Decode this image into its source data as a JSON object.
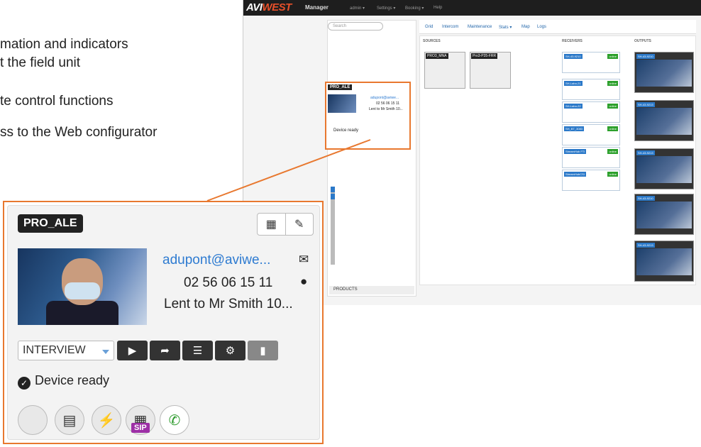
{
  "bullets": [
    "mation and indicators",
    "t the field unit",
    "te control functions",
    "ss to the Web configurator"
  ],
  "app": {
    "logo_a": "AVI",
    "logo_b": "WEST",
    "manager": "Manager",
    "nav": [
      "admin ▾",
      "Settings ▾",
      "Booking ▾",
      "Help"
    ],
    "search_placeholder": "Search",
    "tabs": [
      "Grid",
      "Intercom",
      "Maintenance",
      "Stats ▾",
      "Map",
      "Logs"
    ],
    "col_sources": "SOURCES",
    "col_receivers": "RECEIVERS",
    "col_outputs": "OUTPUTS",
    "sources": [
      "PRO3_MNA",
      "Pro3-P35-FRR"
    ],
    "receivers": [
      "SH-43-9210",
      "SH-Labo-21",
      "SH-Labo-22",
      "SH_BT_3083",
      "StreamHub FTI",
      "StreamHubCSI"
    ],
    "receiver_status": "online",
    "outputs": [
      "SH-43-9210",
      "SH-43-9213",
      "SH-43-9213",
      "SH-43-9210",
      "SH-43-9213"
    ],
    "products": "PRODUCTS"
  },
  "device": {
    "name": "PRO_ALE",
    "email": "adupont@aviwe...",
    "phone": "02 56 06 15 11",
    "lent": "Lent to Mr Smith 10...",
    "profile": "INTERVIEW",
    "status": "Device ready",
    "sip": "SIP"
  },
  "colors": {
    "accent": "#e8782f",
    "link": "#2e7bd1",
    "online": "#2ca02c",
    "sip": "#9d2fa6"
  },
  "icons": [
    "calendar-icon",
    "edit-icon",
    "email-icon",
    "user-icon",
    "play-icon",
    "share-icon",
    "list-icon",
    "gear-icon",
    "signal-icon",
    "check-icon",
    "document-icon",
    "plug-icon",
    "sip-icon",
    "phone-icon"
  ]
}
